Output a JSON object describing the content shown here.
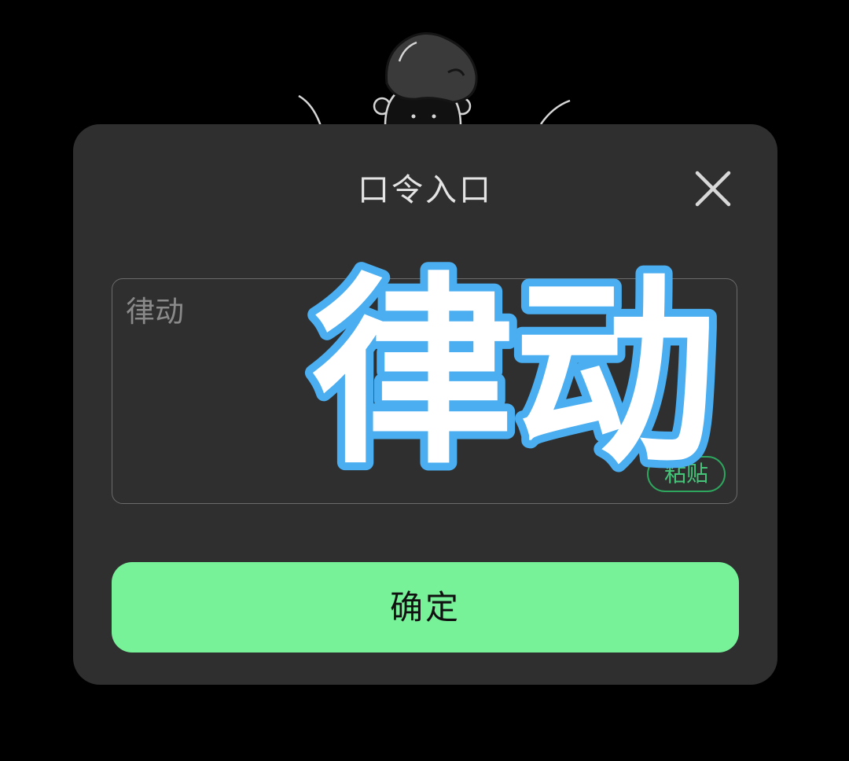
{
  "dialog": {
    "title": "口令入口",
    "close_icon": "close-icon",
    "code_input": {
      "value": "律动"
    },
    "paste_label": "粘贴",
    "confirm_label": "确定"
  },
  "overlay": {
    "text": "律动",
    "fill_color": "#ffffff",
    "outline_color": "#4aaef0"
  },
  "colors": {
    "background": "#000000",
    "dialog_bg": "#2f2f2f",
    "confirm_bg": "#77f299",
    "paste_accent": "#46c57a"
  }
}
